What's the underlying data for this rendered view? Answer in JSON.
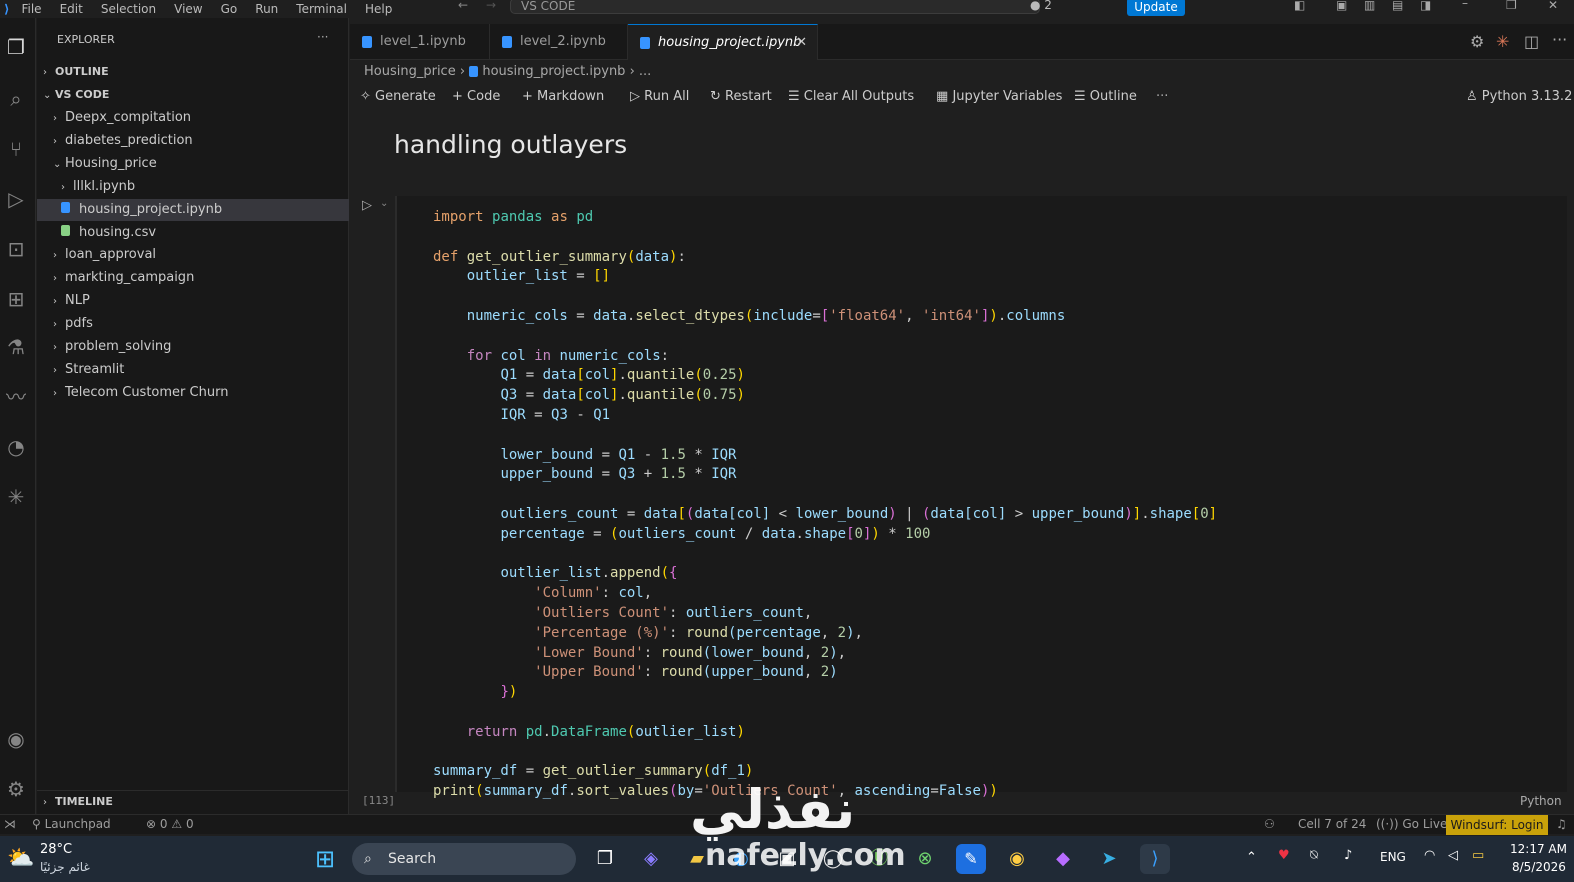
{
  "titlebar": {
    "menu": [
      "File",
      "Edit",
      "Selection",
      "View",
      "Go",
      "Run",
      "Terminal",
      "Help"
    ],
    "command_center": "VS CODE",
    "badge_count": "2",
    "update_label": "Update"
  },
  "sidebar": {
    "header": "EXPLORER",
    "more": "···",
    "outline": "OUTLINE",
    "workspace": "VS CODE",
    "items": [
      {
        "label": "Deepx_compitation",
        "indent": 1,
        "chev": "›"
      },
      {
        "label": "diabetes_prediction",
        "indent": 1,
        "chev": "›"
      },
      {
        "label": "Housing_price",
        "indent": 1,
        "chev": "⌄"
      },
      {
        "label": "lllkl.ipynb",
        "indent": 2,
        "chev": "›"
      },
      {
        "label": "housing_project.ipynb",
        "indent": 2,
        "chev": ""
      },
      {
        "label": "housing.csv",
        "indent": 2,
        "chev": ""
      },
      {
        "label": "loan_approval",
        "indent": 1,
        "chev": "›"
      },
      {
        "label": "markting_campaign",
        "indent": 1,
        "chev": "›"
      },
      {
        "label": "NLP",
        "indent": 1,
        "chev": "›"
      },
      {
        "label": "pdfs",
        "indent": 1,
        "chev": "›"
      },
      {
        "label": "problem_solving",
        "indent": 1,
        "chev": "›"
      },
      {
        "label": "Streamlit",
        "indent": 1,
        "chev": "›"
      },
      {
        "label": "Telecom Customer Churn",
        "indent": 1,
        "chev": "›"
      }
    ],
    "timeline": "TIMELINE"
  },
  "tabs": [
    {
      "label": "level_1.ipynb"
    },
    {
      "label": "level_2.ipynb"
    },
    {
      "label": "housing_project.ipynb",
      "close": "✕"
    }
  ],
  "breadcrumb": {
    "folder": "Housing_price",
    "file": "housing_project.ipynb",
    "tail": "..."
  },
  "toolbar": {
    "generate": "Generate",
    "code": "Code",
    "markdown": "Markdown",
    "run_all": "Run All",
    "restart": "Restart",
    "clear": "Clear All Outputs",
    "variables": "Jupyter Variables",
    "outline": "Outline",
    "more": "···",
    "kernel": "Python 3.13.2"
  },
  "notebook": {
    "heading": "handling outlayers",
    "exec_count": "[113]",
    "language": "Python"
  },
  "statusbar": {
    "launchpad": "Launchpad",
    "errors": "0",
    "warnings": "0",
    "cell": "Cell 7 of 24",
    "golive": "Go Live",
    "windsurf": "Windsurf: Login"
  },
  "taskbar": {
    "temp": "28°C",
    "weather": "غائم جزئيًا",
    "search": "Search",
    "lang": "ENG",
    "time": "12:17 AM",
    "date": "8/5/2026"
  },
  "watermark": {
    "arabic": "نفذلي",
    "latin": "nafezly.com"
  }
}
